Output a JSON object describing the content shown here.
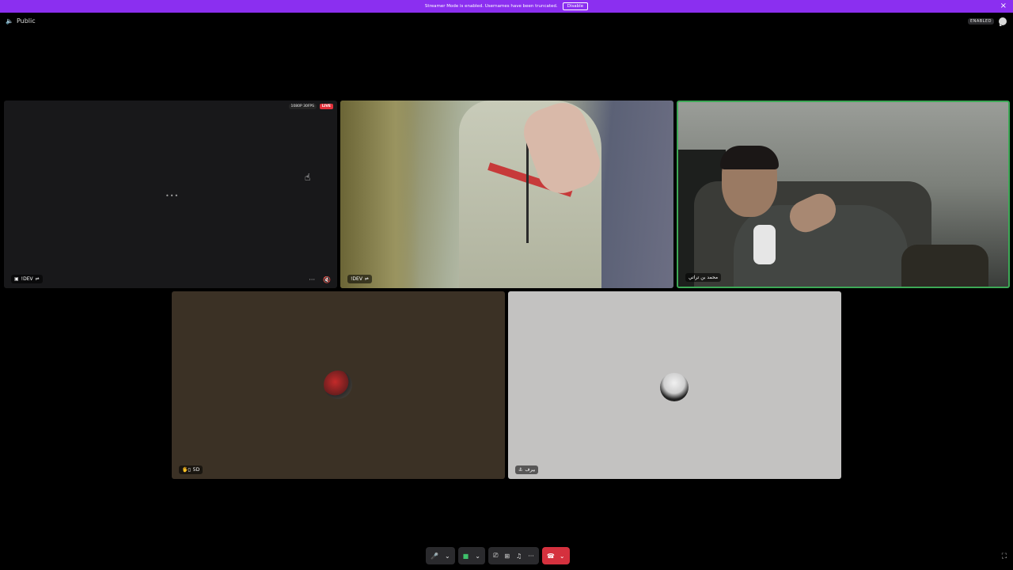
{
  "notice": {
    "text": "Streamer Mode is enabled. Usernames have been truncated.",
    "disable_label": "Disable",
    "close_icon": "×"
  },
  "channel": {
    "privacy_icon": "🔈",
    "privacy_label": "Public"
  },
  "topbar": {
    "enabled_badge": "ENABLED",
    "chat_icon": "chat-bubble-icon"
  },
  "tiles": [
    {
      "quality_badge": "1080P 30FPS",
      "live_badge": "LIVE",
      "loading": "•••",
      "label": "!DEV",
      "label_icon": "▣",
      "label_suffix": "⇌",
      "more_icon": "···",
      "mute_icon": "🔇"
    },
    {
      "label": "!DEV",
      "label_suffix": "⇌"
    },
    {
      "label": "محمد بن تراتي"
    },
    {
      "label": "5D",
      "label_icon": "🖐▯"
    },
    {
      "label": "بيرف",
      "label_icon": "⚓"
    }
  ],
  "controls": {
    "mic_icon": "🎤",
    "chevron": "⌄",
    "camera_icon": "■",
    "screen_share_icon": "⎚",
    "activities_icon": "⊞",
    "soundboard_icon": "♫",
    "more_icon": "···",
    "hangup_icon": "☎"
  },
  "fullscreen_icon": "⛶"
}
